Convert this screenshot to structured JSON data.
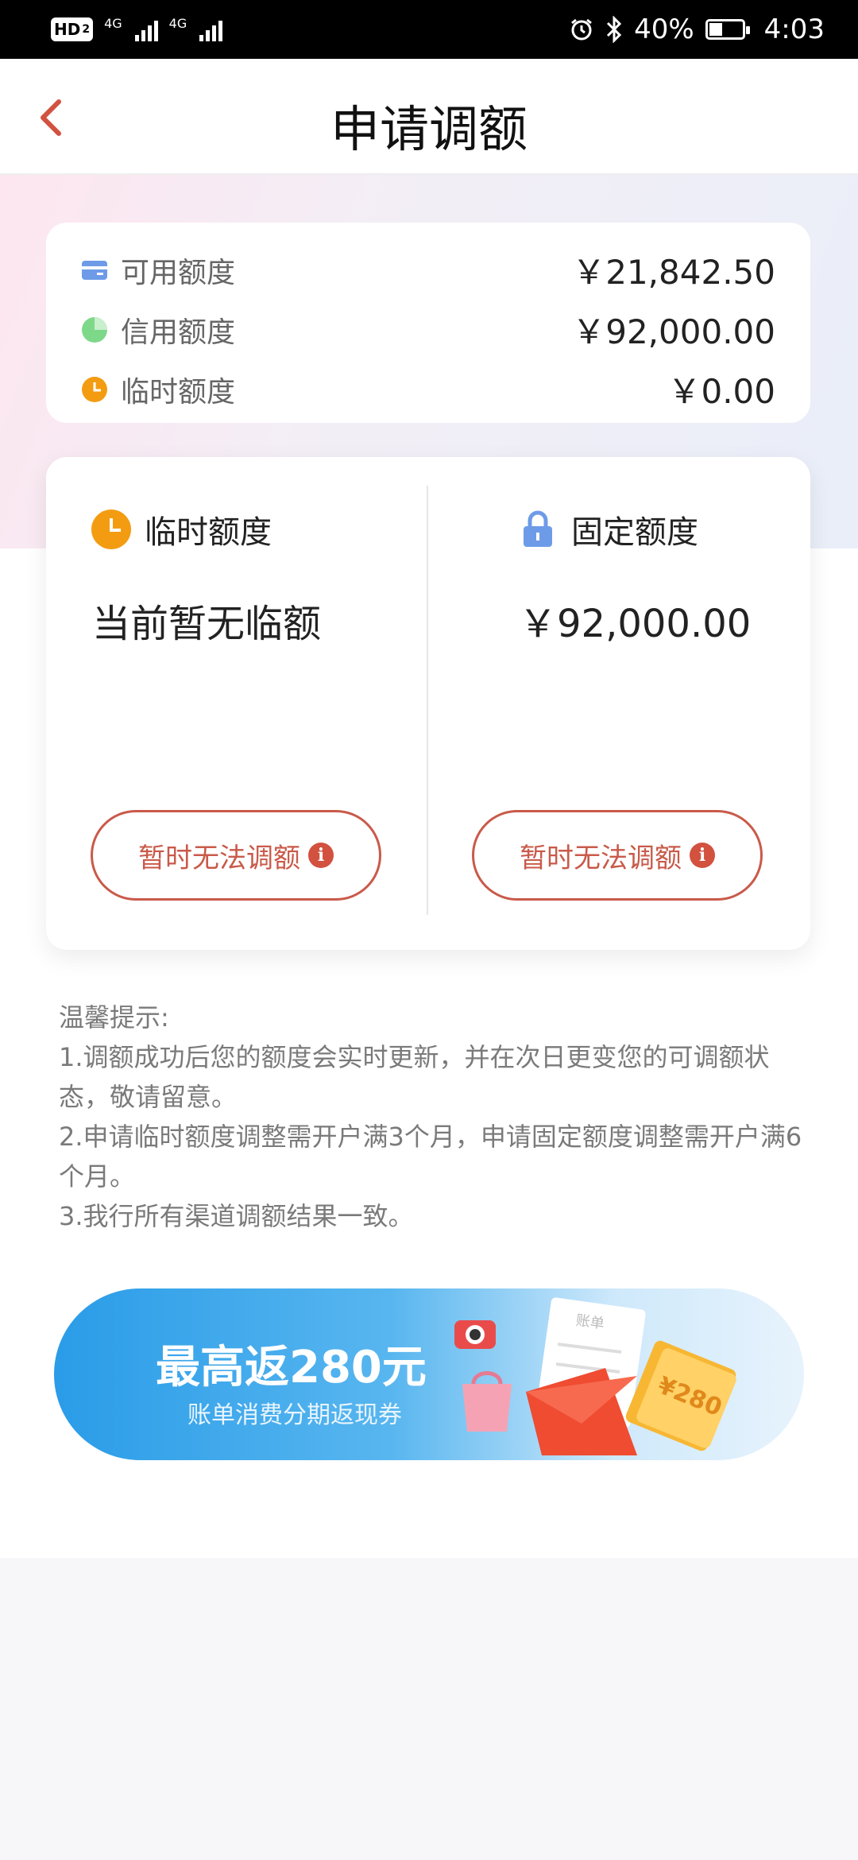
{
  "status_bar": {
    "hd": "HD",
    "sim": "2",
    "net1": "4G",
    "net2": "4G",
    "battery": "40%",
    "time": "4:03"
  },
  "nav": {
    "title": "申请调额"
  },
  "summary": {
    "rows": [
      {
        "label": "可用额度",
        "value": "￥21,842.50",
        "icon": "card-icon"
      },
      {
        "label": "信用额度",
        "value": "￥92,000.00",
        "icon": "pie-icon"
      },
      {
        "label": "临时额度",
        "value": "￥0.00",
        "icon": "clock-icon"
      }
    ]
  },
  "temp_quota": {
    "title": "临时额度",
    "value": "当前暂无临额",
    "button": "暂时无法调额"
  },
  "fixed_quota": {
    "title": "固定额度",
    "value": "￥92,000.00",
    "button": "暂时无法调额"
  },
  "tips": {
    "heading": "温馨提示:",
    "line1": "1.调额成功后您的额度会实时更新，并在次日更变您的可调额状态，敬请留意。",
    "line2": "2.申请临时额度调整需开户满3个月，申请固定额度调整需开户满6个月。",
    "line3": "3.我行所有渠道调额结果一致。"
  },
  "banner": {
    "title": "最高返280元",
    "subtitle": "账单消费分期返现券",
    "bill_label": "账单",
    "coupon_label": "¥280"
  },
  "colors": {
    "accent": "#c95a4a",
    "clock": "#f39c12",
    "card": "#6e9be8",
    "pie": "#7ed88a"
  }
}
